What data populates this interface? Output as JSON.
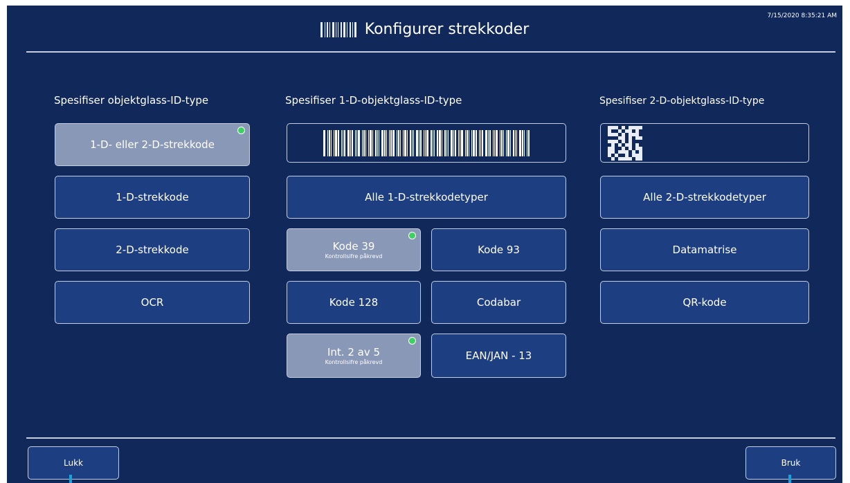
{
  "header": {
    "title": "Konfigurer strekkoder",
    "timestamp": "7/15/2020 8:35:21 AM",
    "barcode_icon": "barcode-icon"
  },
  "columns": {
    "left_label": "Spesifiser objektglass-ID-type",
    "middle_label": "Spesifiser 1-D-objektglass-ID-type",
    "right_label": "Spesifiser 2-D-objektglass-ID-type"
  },
  "left": {
    "btn1": "1-D- eller 2-D-strekkode",
    "btn2": "1-D-strekkode",
    "btn3": "2-D-strekkode",
    "btn4": "OCR"
  },
  "middle": {
    "all": "Alle 1-D-strekkodetyper",
    "kode39": "Kode 39",
    "kode39_sub": "Kontrollsifre påkrevd",
    "kode93": "Kode 93",
    "kode128": "Kode 128",
    "codabar": "Codabar",
    "int25": "Int. 2 av 5",
    "int25_sub": "Kontrollsifre påkrevd",
    "ean": "EAN/JAN - 13"
  },
  "right": {
    "all": "Alle 2-D-strekkodetyper",
    "datamatrix": "Datamatrise",
    "qr": "QR-kode"
  },
  "footer": {
    "close": "Lukk",
    "apply": "Bruk"
  },
  "colors": {
    "background": "#11285a",
    "button": "#1d3e80",
    "selected": "#8a98b7",
    "indicator": "#3dd161",
    "marker": "#1aa2dc"
  }
}
